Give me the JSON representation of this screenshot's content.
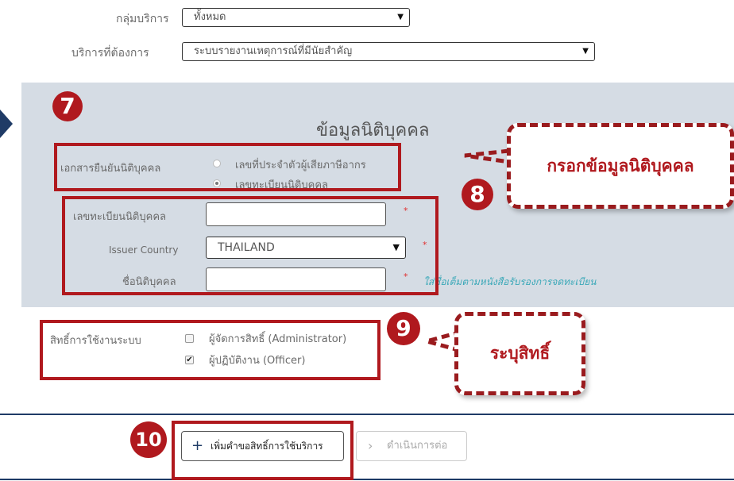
{
  "service_group": {
    "label": "กลุ่มบริการ",
    "value": "ทั้งหมด"
  },
  "service_needed": {
    "label": "บริการที่ต้องการ",
    "value": "ระบบรายงานเหตุการณ์ที่มีนัยสำคัญ"
  },
  "section": {
    "title": "ข้อมูลนิติบุคคล",
    "doc_label": "เอกสารยืนยันนิติบุคคล",
    "radio_tax_id": "เลขที่ประจำตัวผู้เสียภาษีอากร",
    "radio_reg_no": "เลขทะเบียนนิติบุคคล",
    "reg_no_label": "เลขทะเบียนนิติบุคคล",
    "country_label": "Issuer Country",
    "country_value": "THAILAND",
    "name_label": "ชื่อนิติบุคคล",
    "name_hint": "ใส่ชื่อเต็มตามหนังสือรับรองการจดทะเบียน",
    "required_mark": "*"
  },
  "rights": {
    "label": "สิทธิ์การใช้งานระบบ",
    "admin": "ผู้จัดการสิทธิ์ (Administrator)",
    "officer": "ผู้ปฏิบัติงาน (Officer)",
    "admin_checked": false,
    "officer_checked": true
  },
  "buttons": {
    "add_request": "เพิ่มคำขอสิทธิ์การใช้บริการ",
    "add_icon": "+",
    "next": "ดำเนินการต่อ",
    "next_icon": "›"
  },
  "annotations": {
    "step7": "7",
    "step8": "8",
    "step9": "9",
    "step10": "10",
    "callout_fill": "กรอกข้อมูลนิติบุคคล",
    "callout_rights": "ระบุสิทธิ์"
  },
  "colors": {
    "annotation_red": "#b0191e",
    "panel_bg": "#d5dce4",
    "divider": "#1f3b66"
  }
}
